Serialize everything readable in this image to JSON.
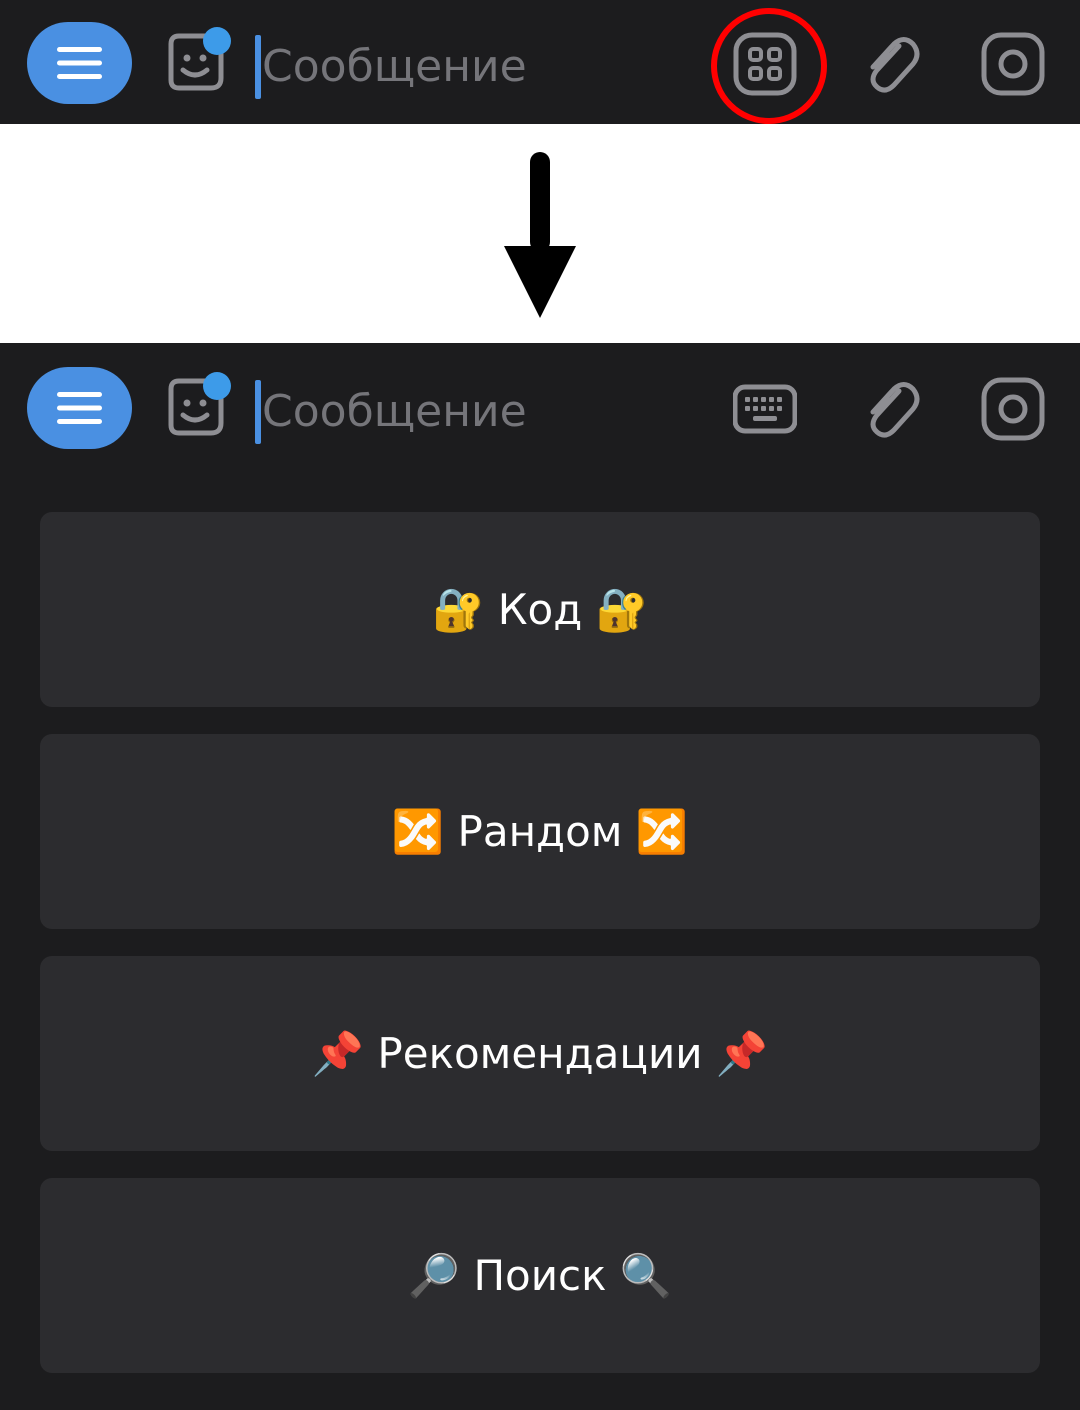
{
  "composer": {
    "placeholder": "Сообщение"
  },
  "colors": {
    "bar_background": "#1c1c1e",
    "accent_blue": "#4a90e2",
    "badge_blue": "#3d9be9",
    "highlight_red": "#ff0000",
    "button_background": "#2c2c2f",
    "icon_gray": "#8e8e93"
  },
  "icons": {
    "menu": "menu-icon",
    "sticker": "sticker-icon",
    "bot_keyboard": "grid-icon",
    "keyboard": "keyboard-icon",
    "attach": "paperclip-icon",
    "camera": "camera-icon",
    "arrow": "arrow-down-icon"
  },
  "reply_keyboard": {
    "buttons": [
      {
        "label": "🔐 Код 🔐"
      },
      {
        "label": "🔀 Рандом 🔀"
      },
      {
        "label": "📌 Рекомендации 📌"
      },
      {
        "label": "🔎 Поиск 🔍"
      }
    ]
  }
}
